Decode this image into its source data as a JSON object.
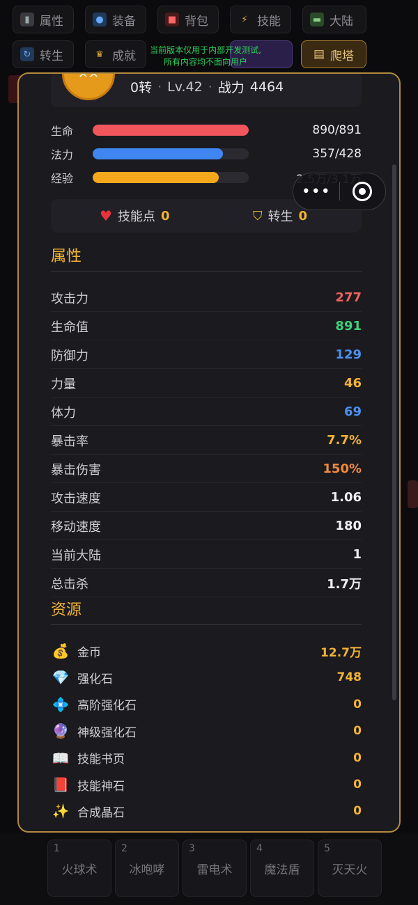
{
  "topnav": {
    "row1": [
      {
        "label": "属性",
        "icon": "chart-icon"
      },
      {
        "label": "装备",
        "icon": "person-icon"
      },
      {
        "label": "背包",
        "icon": "bag-icon"
      },
      {
        "label": "技能",
        "icon": "lightning-icon"
      },
      {
        "label": "大陆",
        "icon": "map-icon"
      }
    ],
    "row2": [
      {
        "label": "转生",
        "icon": "cycle-icon"
      },
      {
        "label": "成就",
        "icon": "trophy-icon"
      }
    ],
    "tower": {
      "label": "爬塔",
      "icon": "tower-icon"
    },
    "notice": [
      "当前版本仅用于内部开发测试,",
      "所有内容均不面向用户"
    ]
  },
  "profile": {
    "rebirth": "0转",
    "level": "Lv.42",
    "power_label": "战力",
    "power_value": "4464",
    "avatar_text": "✕✕"
  },
  "stats": {
    "hp": {
      "label": "生命",
      "value": "890/891",
      "fraction": 0.999,
      "color": "#f0565c"
    },
    "mp": {
      "label": "法力",
      "value": "357/428",
      "fraction": 0.834,
      "color": "#3f86f0"
    },
    "exp": {
      "label": "经验",
      "value": "2.5万/3.1万",
      "fraction": 0.81,
      "color": "#f5a81c"
    }
  },
  "points": {
    "skill": {
      "label": "技能点",
      "value": "0"
    },
    "rebirth": {
      "label": "转生",
      "value": "0"
    }
  },
  "attributes": {
    "title": "属性",
    "rows": [
      {
        "label": "攻击力",
        "value": "277",
        "color": "#f06262"
      },
      {
        "label": "生命值",
        "value": "891",
        "color": "#3fd37a"
      },
      {
        "label": "防御力",
        "value": "129",
        "color": "#4a90f0"
      },
      {
        "label": "力量",
        "value": "46",
        "color": "#f3b433"
      },
      {
        "label": "体力",
        "value": "69",
        "color": "#4a90f0"
      },
      {
        "label": "暴击率",
        "value": "7.7%",
        "color": "#f3b433"
      },
      {
        "label": "暴击伤害",
        "value": "150%",
        "color": "#f08a3c"
      },
      {
        "label": "攻击速度",
        "value": "1.06",
        "color": "#f0f0f2"
      },
      {
        "label": "移动速度",
        "value": "180",
        "color": "#f0f0f2"
      },
      {
        "label": "当前大陆",
        "value": "1",
        "color": "#f0f0f2"
      },
      {
        "label": "总击杀",
        "value": "1.7万",
        "color": "#f0f0f2"
      }
    ]
  },
  "resources": {
    "title": "资源",
    "rows": [
      {
        "label": "金币",
        "value": "12.7万",
        "icon": "money-bag-icon",
        "glyph": "💰"
      },
      {
        "label": "强化石",
        "value": "748",
        "icon": "diamond-icon",
        "glyph": "💎"
      },
      {
        "label": "高阶强化石",
        "value": "0",
        "icon": "crystal-cluster-icon",
        "glyph": "💠"
      },
      {
        "label": "神级强化石",
        "value": "0",
        "icon": "orb-icon",
        "glyph": "🔮"
      },
      {
        "label": "技能书页",
        "value": "0",
        "icon": "book-icon",
        "glyph": "📖"
      },
      {
        "label": "技能神石",
        "value": "0",
        "icon": "tablet-icon",
        "glyph": "📕"
      },
      {
        "label": "合成晶石",
        "value": "0",
        "icon": "sparkles-icon",
        "glyph": "✨"
      }
    ]
  },
  "skills": [
    {
      "num": "1",
      "name": "火球术"
    },
    {
      "num": "2",
      "name": "冰咆哮"
    },
    {
      "num": "3",
      "name": "雷电术"
    },
    {
      "num": "4",
      "name": "魔法盾"
    },
    {
      "num": "5",
      "name": "灭天火"
    }
  ],
  "capsule": {
    "more": "•••"
  }
}
